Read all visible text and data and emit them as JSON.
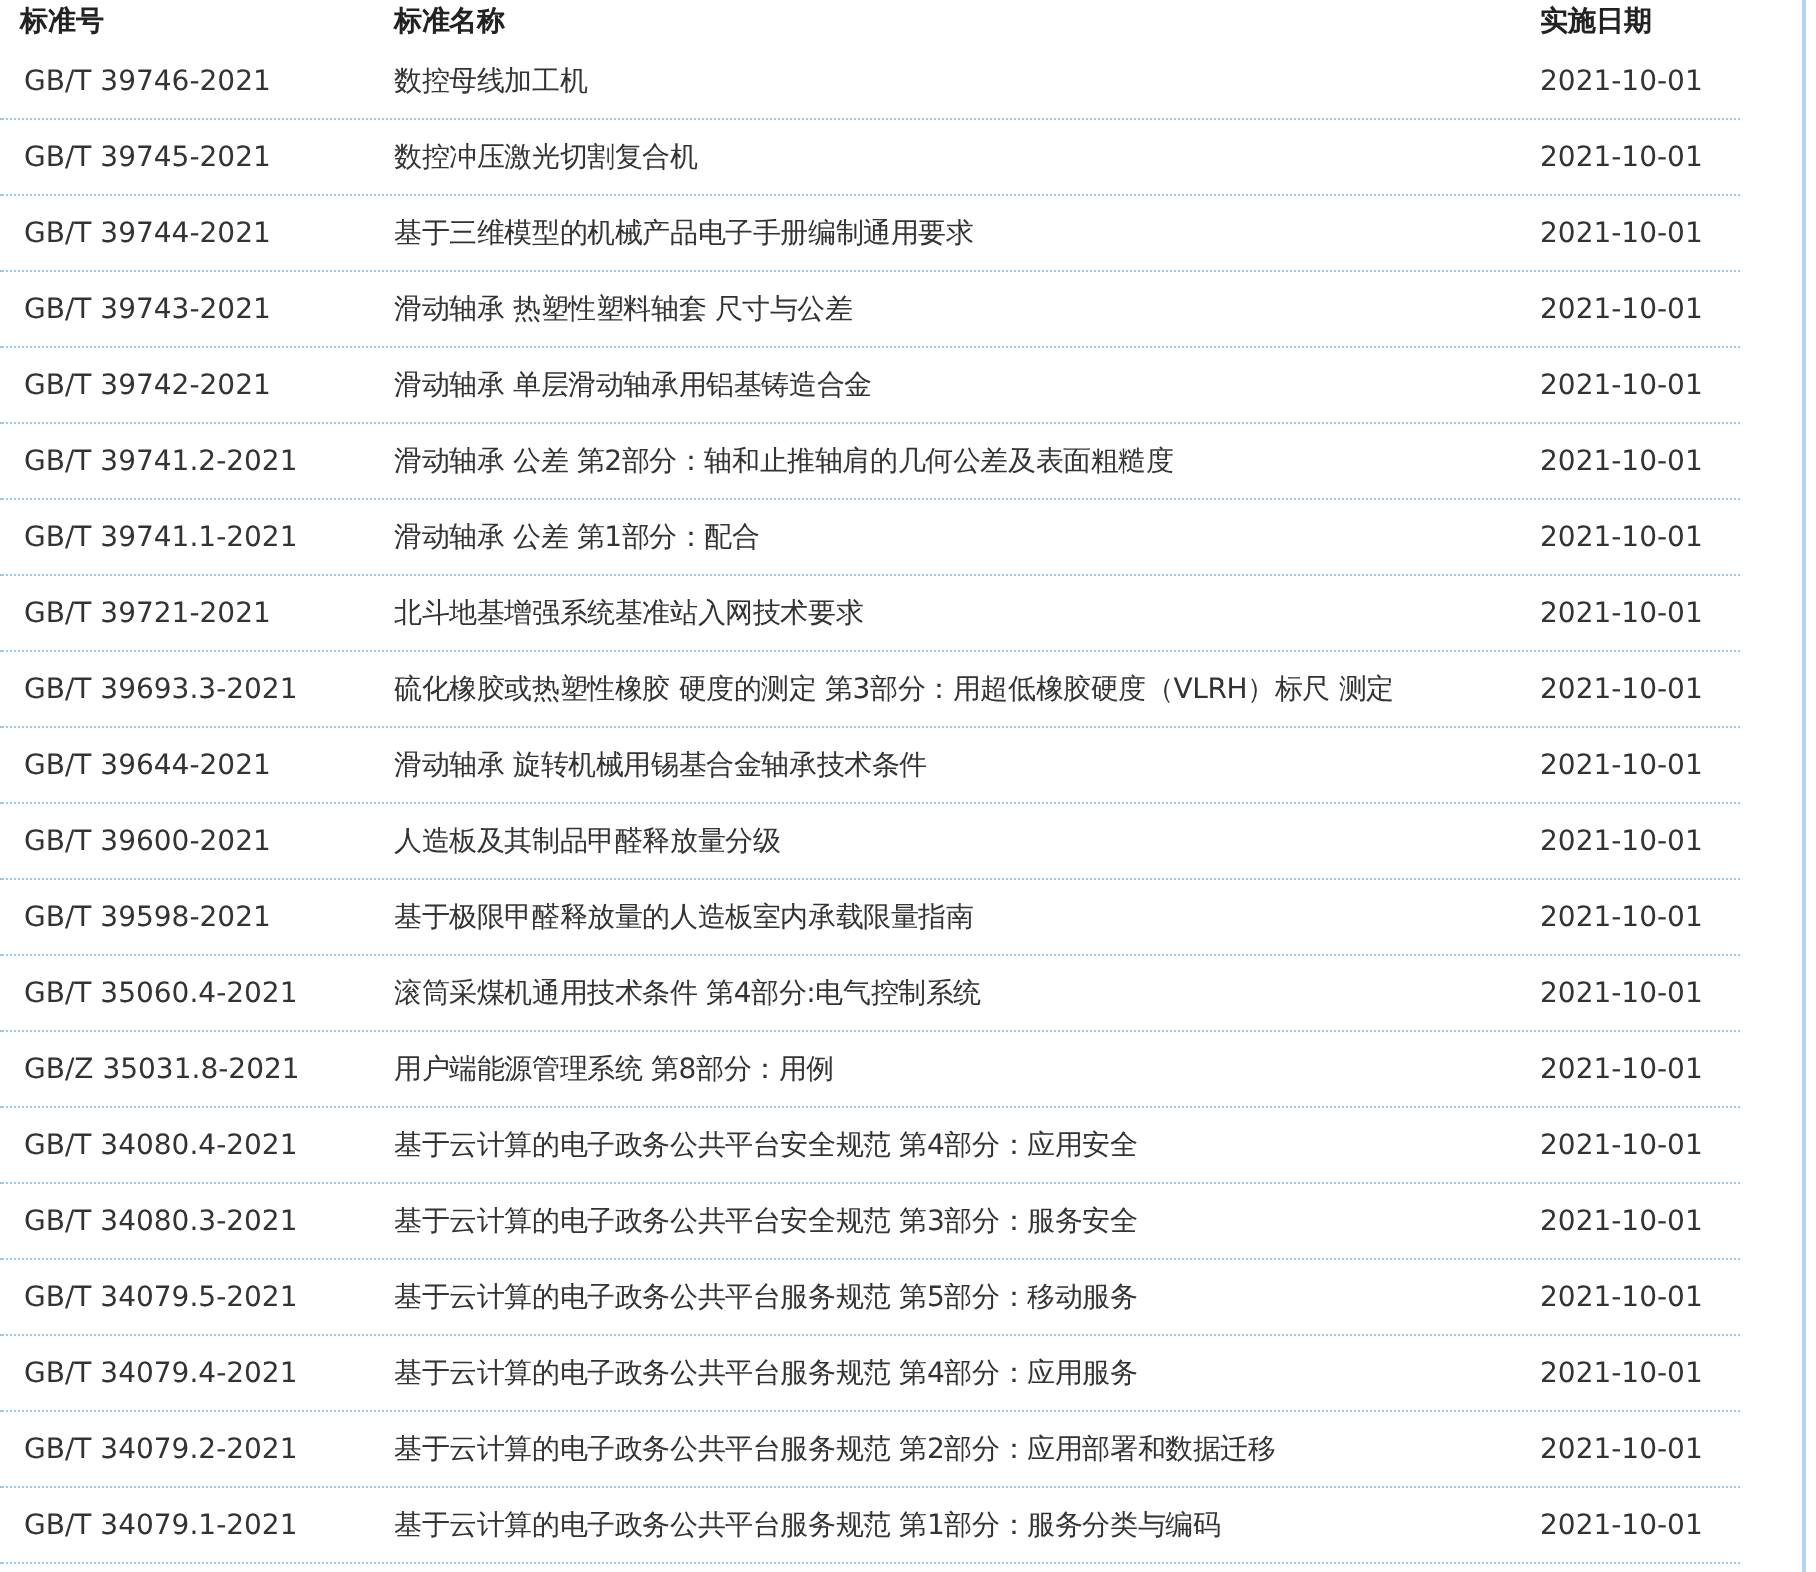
{
  "table": {
    "columns": [
      "标准号",
      "标准名称",
      "实施日期"
    ],
    "rows": [
      {
        "code": "GB/T 39746-2021",
        "name": "数控母线加工机",
        "date": "2021-10-01"
      },
      {
        "code": "GB/T 39745-2021",
        "name": "数控冲压激光切割复合机",
        "date": "2021-10-01"
      },
      {
        "code": "GB/T 39744-2021",
        "name": "基于三维模型的机械产品电子手册编制通用要求",
        "date": "2021-10-01"
      },
      {
        "code": "GB/T 39743-2021",
        "name": "滑动轴承 热塑性塑料轴套 尺寸与公差",
        "date": "2021-10-01"
      },
      {
        "code": "GB/T 39742-2021",
        "name": "滑动轴承 单层滑动轴承用铝基铸造合金",
        "date": "2021-10-01"
      },
      {
        "code": "GB/T 39741.2-2021",
        "name": "滑动轴承 公差 第2部分：轴和止推轴肩的几何公差及表面粗糙度",
        "date": "2021-10-01"
      },
      {
        "code": "GB/T 39741.1-2021",
        "name": "滑动轴承 公差 第1部分：配合",
        "date": "2021-10-01"
      },
      {
        "code": "GB/T 39721-2021",
        "name": "北斗地基增强系统基准站入网技术要求",
        "date": "2021-10-01"
      },
      {
        "code": "GB/T 39693.3-2021",
        "name": "硫化橡胶或热塑性橡胶 硬度的测定 第3部分：用超低橡胶硬度（VLRH）标尺 测定",
        "date": "2021-10-01"
      },
      {
        "code": "GB/T 39644-2021",
        "name": "滑动轴承 旋转机械用锡基合金轴承技术条件",
        "date": "2021-10-01"
      },
      {
        "code": "GB/T 39600-2021",
        "name": "人造板及其制品甲醛释放量分级",
        "date": "2021-10-01"
      },
      {
        "code": "GB/T 39598-2021",
        "name": "基于极限甲醛释放量的人造板室内承载限量指南",
        "date": "2021-10-01"
      },
      {
        "code": "GB/T 35060.4-2021",
        "name": "滚筒采煤机通用技术条件 第4部分:电气控制系统",
        "date": "2021-10-01"
      },
      {
        "code": "GB/Z 35031.8-2021",
        "name": "用户端能源管理系统 第8部分：用例",
        "date": "2021-10-01"
      },
      {
        "code": "GB/T 34080.4-2021",
        "name": "基于云计算的电子政务公共平台安全规范 第4部分：应用安全",
        "date": "2021-10-01"
      },
      {
        "code": "GB/T 34080.3-2021",
        "name": "基于云计算的电子政务公共平台安全规范 第3部分：服务安全",
        "date": "2021-10-01"
      },
      {
        "code": "GB/T 34079.5-2021",
        "name": "基于云计算的电子政务公共平台服务规范 第5部分：移动服务",
        "date": "2021-10-01"
      },
      {
        "code": "GB/T 34079.4-2021",
        "name": "基于云计算的电子政务公共平台服务规范 第4部分：应用服务",
        "date": "2021-10-01"
      },
      {
        "code": "GB/T 34079.2-2021",
        "name": "基于云计算的电子政务公共平台服务规范 第2部分：应用部署和数据迁移",
        "date": "2021-10-01"
      },
      {
        "code": "GB/T 34079.1-2021",
        "name": "基于云计算的电子政务公共平台服务规范 第1部分：服务分类与编码",
        "date": "2021-10-01"
      }
    ]
  }
}
